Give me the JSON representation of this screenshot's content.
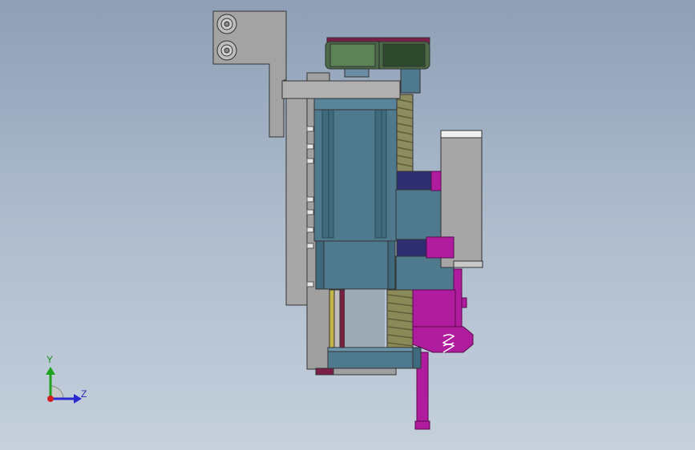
{
  "window": {
    "background_top": "#8e9fb6",
    "background_bottom": "#c5d0dc"
  },
  "triad": {
    "y_label": "Y",
    "z_label": "Z",
    "colors": {
      "y_axis": "#1fa21f",
      "z_axis": "#2a2ad0",
      "origin": "#d02020"
    }
  },
  "model": {
    "colors": {
      "bracket": "#a3a3a3",
      "motor": "#4f7a8e",
      "pulley": "#4d6a48",
      "belt": "#7b1f49",
      "screw": "#8a8a5c",
      "slide_dark": "#2d2d72",
      "gripper": "#b01c9e",
      "outline": "#303030"
    }
  }
}
